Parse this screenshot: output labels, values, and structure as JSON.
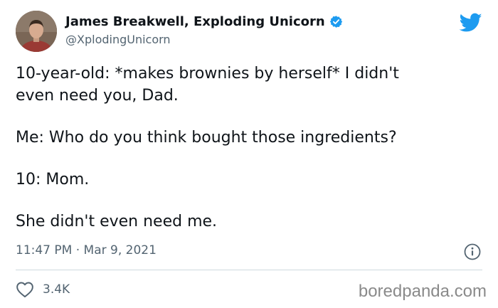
{
  "author": {
    "display_name": "James Breakwell, Exploding Unicorn",
    "handle": "@XplodingUnicorn",
    "verified": true
  },
  "tweet": {
    "paragraphs": [
      "10-year-old: *makes brownies by herself* I didn't\neven need you, Dad.",
      "Me: Who do you think bought those ingredients?",
      "10: Mom.",
      "She didn't even need me."
    ],
    "timestamp": "11:47 PM · Mar 9, 2021",
    "like_count": "3.4K"
  },
  "icons": {
    "brand": "twitter-bird-icon",
    "verified": "verified-badge-icon",
    "info": "info-icon",
    "like": "heart-icon"
  },
  "colors": {
    "twitter_blue": "#1d9bf0",
    "text_primary": "#0f1419",
    "text_secondary": "#536471",
    "divider": "#cfd9de",
    "watermark": "#8a8a8a"
  },
  "watermark": "boredpanda.com"
}
